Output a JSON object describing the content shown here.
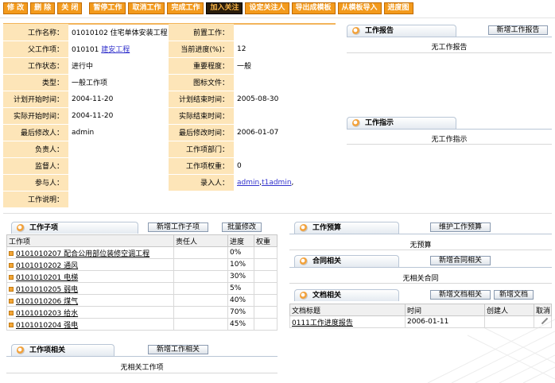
{
  "toolbar": {
    "buttons": [
      "修 改",
      "删 除",
      "关 闭",
      "暂停工作",
      "取消工作",
      "完成工作",
      "加入关注",
      "设定关注人",
      "导出成模板",
      "从模板导入",
      "进度图"
    ]
  },
  "info": {
    "rows": [
      {
        "l1": "工作名称：",
        "v1": "01010102  住宅单体安装工程",
        "l2": "前置工作：",
        "v2": ""
      },
      {
        "l1": "父工作项：",
        "v1": "010101",
        "v1_link": "建安工程",
        "l2": "当前进度(%)：",
        "v2": "12"
      },
      {
        "l1": "工作状态：",
        "v1": "进行中",
        "l2": "重要程度：",
        "v2": "一般"
      },
      {
        "l1": "类型：",
        "v1": "一般工作项",
        "l2": "图标文件：",
        "v2": ""
      },
      {
        "l1": "计划开始时间：",
        "v1": "2004-11-20",
        "l2": "计划结束时间：",
        "v2": "2005-08-30"
      },
      {
        "l1": "实际开始时间：",
        "v1": "2004-11-20",
        "l2": "实际结束时间：",
        "v2": ""
      },
      {
        "l1": "最后修改人：",
        "v1": "admin",
        "l2": "最后修改时间：",
        "v2": "2006-01-07"
      },
      {
        "l1": "负责人：",
        "v1": "",
        "l2": "工作项部门：",
        "v2": ""
      },
      {
        "l1": "监督人：",
        "v1": "",
        "l2": "工作项权重：",
        "v2": "0"
      },
      {
        "l1": "参与人：",
        "v1": "",
        "l2": "录入人：",
        "v2": ""
      }
    ],
    "entry_people": [
      "admin",
      "t1admin"
    ],
    "desc_label": "工作说明："
  },
  "work_report": {
    "title": "工作报告",
    "button": "新增工作报告",
    "empty": "无工作报告"
  },
  "work_instruction": {
    "title": "工作指示",
    "empty": "无工作指示"
  },
  "subitems": {
    "title": "工作子项",
    "btn_add": "新增工作子项",
    "btn_batch": "批量修改",
    "headers": [
      "工作项",
      "责任人",
      "进度",
      "权重"
    ],
    "rows": [
      {
        "name": "0101010207  配合公用部位装修空调工程",
        "owner": "",
        "progress": "0%",
        "weight": ""
      },
      {
        "name": "0101010202  通风",
        "owner": "",
        "progress": "10%",
        "weight": ""
      },
      {
        "name": "0101010201  电梯",
        "owner": "",
        "progress": "30%",
        "weight": ""
      },
      {
        "name": "0101010205  弱电",
        "owner": "",
        "progress": "5%",
        "weight": ""
      },
      {
        "name": "0101010206  煤气",
        "owner": "",
        "progress": "40%",
        "weight": ""
      },
      {
        "name": "0101010203  给水",
        "owner": "",
        "progress": "70%",
        "weight": ""
      },
      {
        "name": "0101010204  强电",
        "owner": "",
        "progress": "45%",
        "weight": ""
      }
    ]
  },
  "related": {
    "title": "工作项相关",
    "button": "新增工作相关",
    "empty": "无相关工作项"
  },
  "budget": {
    "title": "工作预算",
    "button": "维护工作预算",
    "empty": "无预算"
  },
  "contract": {
    "title": "合同相关",
    "button": "新增合同相关",
    "empty": "无相关合同"
  },
  "docs": {
    "title": "文档相关",
    "btn_add_rel": "新增文档相关",
    "btn_add_doc": "新增文档",
    "headers": [
      "文档标题",
      "时间",
      "创建人",
      "取消"
    ],
    "rows": [
      {
        "title": "0111工作进度报告",
        "time": "2006-01-11",
        "creator": ""
      }
    ]
  },
  "colors": {
    "toolbar": "#f39a1c",
    "label_bg": "#fde5b8",
    "link": "#3333cc"
  }
}
